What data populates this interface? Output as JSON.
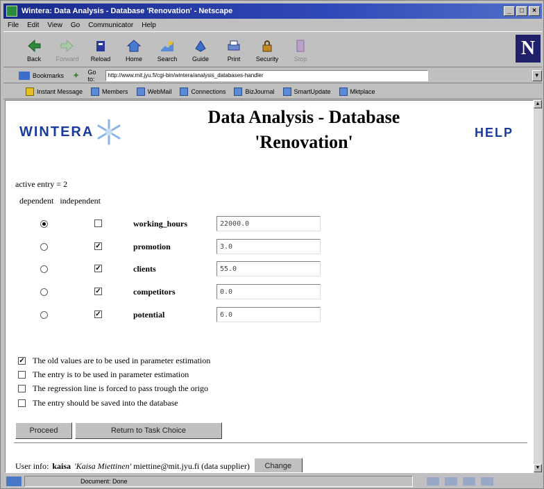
{
  "window": {
    "title": "Wintera: Data Analysis - Database 'Renovation' - Netscape",
    "controls": [
      "_",
      "□",
      "×"
    ]
  },
  "menu": [
    "File",
    "Edit",
    "View",
    "Go",
    "Communicator",
    "Help"
  ],
  "toolbar": {
    "buttons": [
      {
        "label": "Back",
        "icon": "back-arrow-icon",
        "enabled": true
      },
      {
        "label": "Forward",
        "icon": "forward-arrow-icon",
        "enabled": false
      },
      {
        "label": "Reload",
        "icon": "reload-icon",
        "enabled": true
      },
      {
        "label": "Home",
        "icon": "home-icon",
        "enabled": true
      },
      {
        "label": "Search",
        "icon": "search-icon",
        "enabled": true
      },
      {
        "label": "Guide",
        "icon": "guide-icon",
        "enabled": true
      },
      {
        "label": "Print",
        "icon": "print-icon",
        "enabled": true
      },
      {
        "label": "Security",
        "icon": "security-lock-icon",
        "enabled": true
      },
      {
        "label": "Stop",
        "icon": "stop-icon",
        "enabled": false
      }
    ],
    "logo": "N"
  },
  "location": {
    "bookmarks_label": "Bookmarks",
    "goto_label": "Go to:",
    "url": "http://www.mit.jyu.fi/cgi-bin/wintera/analysis_databases-handler"
  },
  "personal_toolbar": [
    "Instant Message",
    "Members",
    "WebMail",
    "Connections",
    "BizJournal",
    "SmartUpdate",
    "Mktplace"
  ],
  "page": {
    "logo_text": "WINTERA",
    "title_line1": "Data Analysis - Database",
    "title_line2": "'Renovation'",
    "help_label": "HELP",
    "active_entry": "active entry = 2",
    "col_dependent": "dependent",
    "col_independent": "independent",
    "parameters": [
      {
        "name": "working_hours",
        "value": "22000.0",
        "dependent": true,
        "independent": false
      },
      {
        "name": "promotion",
        "value": "3.0",
        "dependent": false,
        "independent": true
      },
      {
        "name": "clients",
        "value": "55.0",
        "dependent": false,
        "independent": true
      },
      {
        "name": "competitors",
        "value": "0.0",
        "dependent": false,
        "independent": true
      },
      {
        "name": "potential",
        "value": "6.0",
        "dependent": false,
        "independent": true
      }
    ],
    "options": [
      {
        "label": "The old values are to be used in parameter estimation",
        "checked": true
      },
      {
        "label": "The entry is to be used in parameter estimation",
        "checked": false
      },
      {
        "label": "The regression line is forced to pass trough the origo",
        "checked": false
      },
      {
        "label": "The entry should be saved into the database",
        "checked": false
      }
    ],
    "proceed_label": "Proceed",
    "return_label": "Return to Task Choice",
    "user_info_label": "User info:",
    "user_id": "kaisa",
    "user_name": "'Kaisa Miettinen'",
    "user_email_role": "miettine@mit.jyu.fi (data supplier)",
    "change_label": "Change"
  },
  "status": {
    "text": "Document: Done"
  }
}
